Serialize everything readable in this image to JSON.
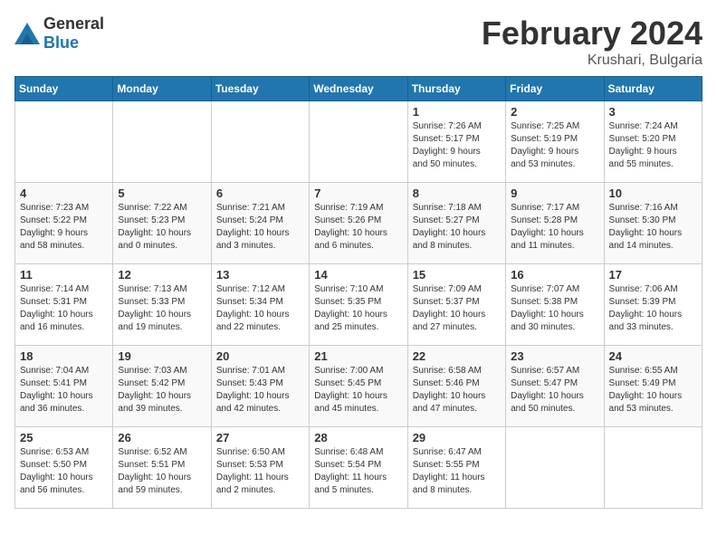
{
  "header": {
    "logo": {
      "general": "General",
      "blue": "Blue"
    },
    "title": "February 2024",
    "subtitle": "Krushari, Bulgaria"
  },
  "weekdays": [
    "Sunday",
    "Monday",
    "Tuesday",
    "Wednesday",
    "Thursday",
    "Friday",
    "Saturday"
  ],
  "weeks": [
    [
      {
        "day": "",
        "info": ""
      },
      {
        "day": "",
        "info": ""
      },
      {
        "day": "",
        "info": ""
      },
      {
        "day": "",
        "info": ""
      },
      {
        "day": "1",
        "info": "Sunrise: 7:26 AM\nSunset: 5:17 PM\nDaylight: 9 hours\nand 50 minutes."
      },
      {
        "day": "2",
        "info": "Sunrise: 7:25 AM\nSunset: 5:19 PM\nDaylight: 9 hours\nand 53 minutes."
      },
      {
        "day": "3",
        "info": "Sunrise: 7:24 AM\nSunset: 5:20 PM\nDaylight: 9 hours\nand 55 minutes."
      }
    ],
    [
      {
        "day": "4",
        "info": "Sunrise: 7:23 AM\nSunset: 5:22 PM\nDaylight: 9 hours\nand 58 minutes."
      },
      {
        "day": "5",
        "info": "Sunrise: 7:22 AM\nSunset: 5:23 PM\nDaylight: 10 hours\nand 0 minutes."
      },
      {
        "day": "6",
        "info": "Sunrise: 7:21 AM\nSunset: 5:24 PM\nDaylight: 10 hours\nand 3 minutes."
      },
      {
        "day": "7",
        "info": "Sunrise: 7:19 AM\nSunset: 5:26 PM\nDaylight: 10 hours\nand 6 minutes."
      },
      {
        "day": "8",
        "info": "Sunrise: 7:18 AM\nSunset: 5:27 PM\nDaylight: 10 hours\nand 8 minutes."
      },
      {
        "day": "9",
        "info": "Sunrise: 7:17 AM\nSunset: 5:28 PM\nDaylight: 10 hours\nand 11 minutes."
      },
      {
        "day": "10",
        "info": "Sunrise: 7:16 AM\nSunset: 5:30 PM\nDaylight: 10 hours\nand 14 minutes."
      }
    ],
    [
      {
        "day": "11",
        "info": "Sunrise: 7:14 AM\nSunset: 5:31 PM\nDaylight: 10 hours\nand 16 minutes."
      },
      {
        "day": "12",
        "info": "Sunrise: 7:13 AM\nSunset: 5:33 PM\nDaylight: 10 hours\nand 19 minutes."
      },
      {
        "day": "13",
        "info": "Sunrise: 7:12 AM\nSunset: 5:34 PM\nDaylight: 10 hours\nand 22 minutes."
      },
      {
        "day": "14",
        "info": "Sunrise: 7:10 AM\nSunset: 5:35 PM\nDaylight: 10 hours\nand 25 minutes."
      },
      {
        "day": "15",
        "info": "Sunrise: 7:09 AM\nSunset: 5:37 PM\nDaylight: 10 hours\nand 27 minutes."
      },
      {
        "day": "16",
        "info": "Sunrise: 7:07 AM\nSunset: 5:38 PM\nDaylight: 10 hours\nand 30 minutes."
      },
      {
        "day": "17",
        "info": "Sunrise: 7:06 AM\nSunset: 5:39 PM\nDaylight: 10 hours\nand 33 minutes."
      }
    ],
    [
      {
        "day": "18",
        "info": "Sunrise: 7:04 AM\nSunset: 5:41 PM\nDaylight: 10 hours\nand 36 minutes."
      },
      {
        "day": "19",
        "info": "Sunrise: 7:03 AM\nSunset: 5:42 PM\nDaylight: 10 hours\nand 39 minutes."
      },
      {
        "day": "20",
        "info": "Sunrise: 7:01 AM\nSunset: 5:43 PM\nDaylight: 10 hours\nand 42 minutes."
      },
      {
        "day": "21",
        "info": "Sunrise: 7:00 AM\nSunset: 5:45 PM\nDaylight: 10 hours\nand 45 minutes."
      },
      {
        "day": "22",
        "info": "Sunrise: 6:58 AM\nSunset: 5:46 PM\nDaylight: 10 hours\nand 47 minutes."
      },
      {
        "day": "23",
        "info": "Sunrise: 6:57 AM\nSunset: 5:47 PM\nDaylight: 10 hours\nand 50 minutes."
      },
      {
        "day": "24",
        "info": "Sunrise: 6:55 AM\nSunset: 5:49 PM\nDaylight: 10 hours\nand 53 minutes."
      }
    ],
    [
      {
        "day": "25",
        "info": "Sunrise: 6:53 AM\nSunset: 5:50 PM\nDaylight: 10 hours\nand 56 minutes."
      },
      {
        "day": "26",
        "info": "Sunrise: 6:52 AM\nSunset: 5:51 PM\nDaylight: 10 hours\nand 59 minutes."
      },
      {
        "day": "27",
        "info": "Sunrise: 6:50 AM\nSunset: 5:53 PM\nDaylight: 11 hours\nand 2 minutes."
      },
      {
        "day": "28",
        "info": "Sunrise: 6:48 AM\nSunset: 5:54 PM\nDaylight: 11 hours\nand 5 minutes."
      },
      {
        "day": "29",
        "info": "Sunrise: 6:47 AM\nSunset: 5:55 PM\nDaylight: 11 hours\nand 8 minutes."
      },
      {
        "day": "",
        "info": ""
      },
      {
        "day": "",
        "info": ""
      }
    ]
  ]
}
